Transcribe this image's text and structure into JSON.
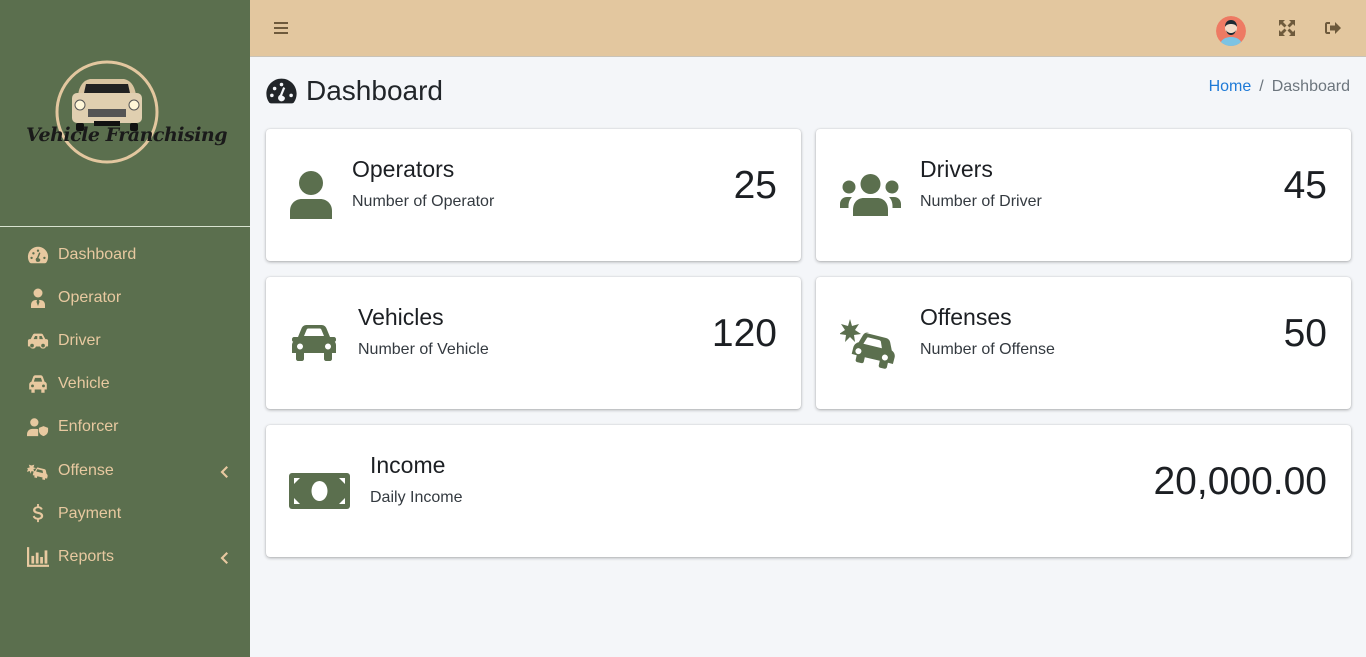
{
  "app": {
    "brand_name": "Vehicle Franchising"
  },
  "sidebar": {
    "items": [
      {
        "label": "Dashboard",
        "icon": "tachometer-icon",
        "has_submenu": false
      },
      {
        "label": "Operator",
        "icon": "user-tie-icon",
        "has_submenu": false
      },
      {
        "label": "Driver",
        "icon": "car-side-icon",
        "has_submenu": false
      },
      {
        "label": "Vehicle",
        "icon": "car-icon",
        "has_submenu": false
      },
      {
        "label": "Enforcer",
        "icon": "user-shield-icon",
        "has_submenu": false
      },
      {
        "label": "Offense",
        "icon": "car-crash-icon",
        "has_submenu": true
      },
      {
        "label": "Payment",
        "icon": "dollar-icon",
        "has_submenu": false
      },
      {
        "label": "Reports",
        "icon": "chart-bar-icon",
        "has_submenu": true
      }
    ]
  },
  "topbar": {
    "menu_icon": "bars-icon",
    "avatar": "user-avatar",
    "fullscreen_icon": "expand-arrows-icon",
    "logout_icon": "sign-out-icon"
  },
  "header": {
    "title": "Dashboard",
    "breadcrumb": {
      "home": "Home",
      "separator": "/",
      "current": "Dashboard"
    }
  },
  "colors": {
    "sidebar_bg": "#5b6f4e",
    "sidebar_text": "#e8c9a0",
    "topbar_bg": "#e3c79f",
    "accent_icon": "#5b6f4e",
    "link": "#1e7ad7"
  },
  "cards": {
    "operators": {
      "title": "Operators",
      "subtitle": "Number of Operator",
      "value": "25"
    },
    "drivers": {
      "title": "Drivers",
      "subtitle": "Number of Driver",
      "value": "45"
    },
    "vehicles": {
      "title": "Vehicles",
      "subtitle": "Number of Vehicle",
      "value": "120"
    },
    "offenses": {
      "title": "Offenses",
      "subtitle": "Number of Offense",
      "value": "50"
    },
    "income": {
      "title": "Income",
      "subtitle": "Daily Income",
      "value": "20,000.00"
    }
  }
}
